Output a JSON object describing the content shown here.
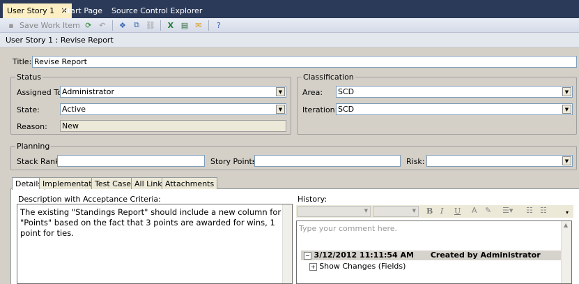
{
  "tabs": [
    {
      "label": "User Story 1",
      "active": true
    },
    {
      "label": "Start Page"
    },
    {
      "label": "Source Control Explorer"
    }
  ],
  "toolbar": {
    "save_label": "Save Work Item"
  },
  "breadcrumb": "User Story 1 : Revise Report",
  "title": {
    "label": "Title:",
    "value": "Revise Report"
  },
  "status": {
    "label": "Status",
    "assigned_label": "Assigned To:",
    "assigned": "Administrator",
    "state_label": "State:",
    "state": "Active",
    "reason_label": "Reason:",
    "reason": "New"
  },
  "classification": {
    "label": "Classification",
    "area_label": "Area:",
    "area": "SCD",
    "iteration_label": "Iteration:",
    "iteration": "SCD"
  },
  "planning": {
    "label": "Planning",
    "stack_rank_label": "Stack Rank:",
    "stack_rank": "",
    "story_points_label": "Story Points:",
    "story_points": "",
    "risk_label": "Risk:",
    "risk": ""
  },
  "panel_tabs": [
    "Details",
    "Implementation",
    "Test Cases",
    "All Links",
    "Attachments"
  ],
  "details": {
    "desc_label": "Description with Acceptance Criteria:",
    "description": "The existing \"Standings Report\" should include a new column for \"Points\" based on the fact that 3 points are awarded for wins, 1 point for ties.",
    "history_label": "History:",
    "comment_placeholder": "Type your comment here.",
    "history_entry": {
      "timestamp": "3/12/2012 11:11:54 AM",
      "created_by": "Created by Administrator",
      "show_changes": "Show Changes (Fields)"
    }
  }
}
